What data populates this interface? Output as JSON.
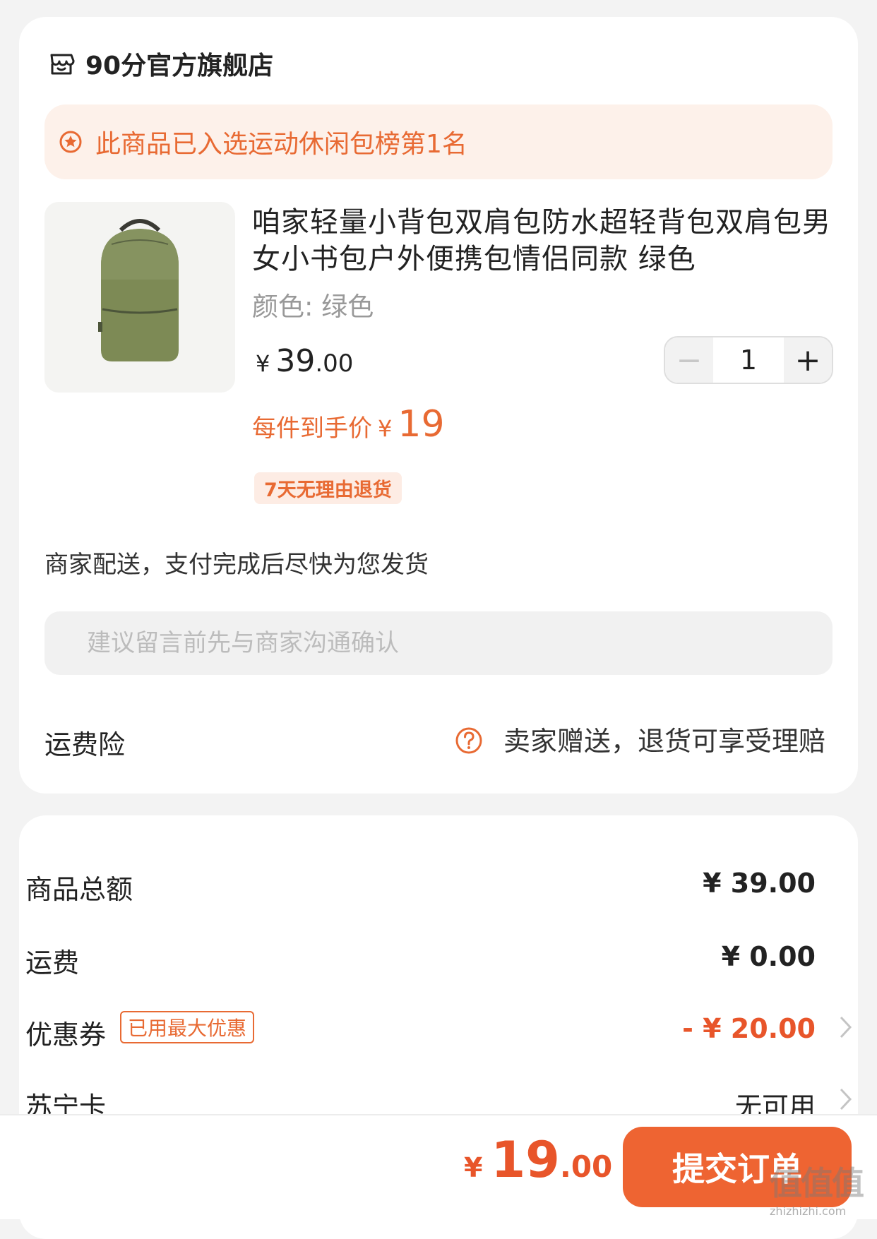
{
  "store": {
    "name": "90分官方旗舰店",
    "icon": "store-icon"
  },
  "rank_banner": {
    "text": "此商品已入选运动休闲包榜第1名",
    "icon": "rank-star-icon",
    "color": "#e86a33"
  },
  "product": {
    "image": "green-backpack",
    "title": "咱家轻量小背包双肩包防水超轻背包双肩包男女小书包户外便携包情侣同款 绿色",
    "variant": "颜色: 绿色",
    "price_yen": "¥",
    "price_int": "39",
    "price_cents": ".00",
    "quantity": "1",
    "minus_label": "−",
    "plus_label": "+",
    "deal_label": "每件到手价",
    "deal_yen": "¥",
    "deal_value": "19",
    "return_badge": "7天无理由退货"
  },
  "delivery_text": "商家配送，支付完成后尽快为您发货",
  "message_placeholder": "建议留言前先与商家沟通确认",
  "insurance": {
    "label": "运费险",
    "text": "卖家赠送，退货可享受理赔",
    "icon": "question-circle-icon"
  },
  "summary": {
    "goods_total_label": "商品总额",
    "goods_total_value": "¥ 39.00",
    "shipping_label": "运费",
    "shipping_value": "¥ 0.00",
    "coupon_label": "优惠券",
    "coupon_tag": "已用最大优惠",
    "coupon_value": "- ¥ 20.00",
    "suning_card_label": "苏宁卡",
    "suning_card_value": "无可用"
  },
  "footer": {
    "total_yen": "¥",
    "total_int": "19",
    "total_cents": ".00",
    "submit_label": "提交订单"
  },
  "watermark": {
    "logo": "值值值",
    "url": "zhizhizhi.com"
  },
  "colors": {
    "accent": "#e86a33",
    "price_red": "#e8552a",
    "button": "#ee6432",
    "banner_bg": "#fdf1ea"
  }
}
